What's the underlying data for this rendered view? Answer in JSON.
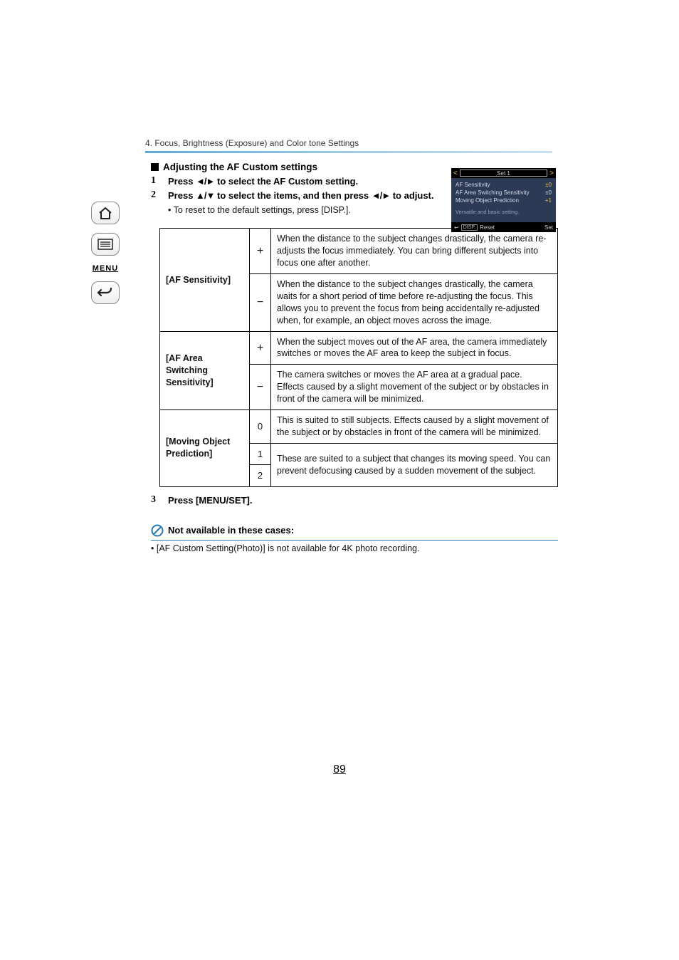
{
  "sidebar": {
    "home_icon": "⌂",
    "list_icon": "≡",
    "menu_label": "MENU",
    "back_icon": "↶"
  },
  "header": {
    "breadcrumb": "4. Focus, Brightness (Exposure) and Color tone Settings"
  },
  "section": {
    "title": "Adjusting the AF Custom settings"
  },
  "steps": {
    "s1_num": "1",
    "s1_text_a": "Press ",
    "s1_arrows": "◄/►",
    "s1_text_b": " to select the AF Custom setting.",
    "s2_num": "2",
    "s2_text_a": "Press ",
    "s2_arrows1": "▲/▼",
    "s2_text_b": " to select the items, and then press ",
    "s2_arrows2": "◄/►",
    "s2_text_c": " to adjust.",
    "s2_sub": "• To reset to the default settings, press [DISP.].",
    "s3_num": "3",
    "s3_text": "Press [MENU/SET]."
  },
  "cam": {
    "title": "Set 1",
    "r1_label": "AF Sensitivity",
    "r1_val": "±0",
    "r2_label": "AF Area Switching Sensitivity",
    "r2_val": "±0",
    "r3_label": "Moving Object Prediction",
    "r3_val": "+1",
    "desc": "Versatile and basic setting.",
    "foot_left_icon": "↩",
    "foot_disp": "DISP.",
    "foot_reset": "Reset",
    "foot_set": "Set"
  },
  "table": {
    "r1_label": "[AF Sensitivity]",
    "r1a_sign": "+",
    "r1a_desc": "When the distance to the subject changes drastically, the camera re-adjusts the focus immediately. You can bring different subjects into focus one after another.",
    "r1b_sign": "−",
    "r1b_desc": "When the distance to the subject changes drastically, the camera waits for a short period of time before re-adjusting the focus. This allows you to prevent the focus from being accidentally re-adjusted when, for example, an object moves across the image.",
    "r2_label": "[AF Area Switching Sensitivity]",
    "r2a_sign": "+",
    "r2a_desc": "When the subject moves out of the AF area, the camera immediately switches or moves the AF area to keep the subject in focus.",
    "r2b_sign": "−",
    "r2b_desc": "The camera switches or moves the AF area at a gradual pace. Effects caused by a slight movement of the subject or by obstacles in front of the camera will be minimized.",
    "r3_label": "[Moving Object Prediction]",
    "r3a_sign": "0",
    "r3a_desc": "This is suited to still subjects. Effects caused by a slight movement of the subject or by obstacles in front of the camera will be minimized.",
    "r3b_sign": "1",
    "r3b_desc": "These are suited to a subject that changes its moving speed. You can prevent defocusing caused by a sudden movement of the subject.",
    "r3c_sign": "2"
  },
  "note": {
    "heading": "Not available in these cases:",
    "body": "• [AF Custom Setting(Photo)] is not available for 4K photo recording."
  },
  "page_number": "89"
}
